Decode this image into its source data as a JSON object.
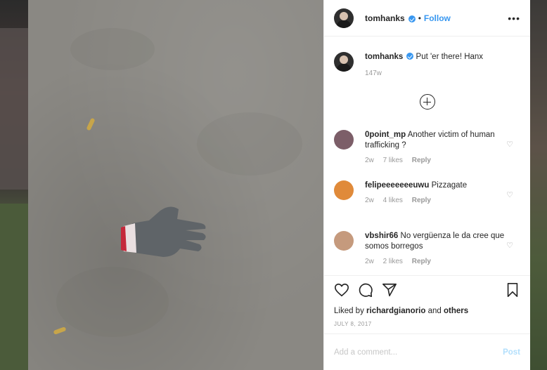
{
  "post": {
    "username": "tomhanks",
    "separator": "•",
    "follow_label": "Follow",
    "more_label": "•••",
    "caption_text": "Put 'er there! Hanx",
    "caption_time": "147w"
  },
  "comments": [
    {
      "user": "0point_mp",
      "text": "Another victim of human trafficking ?",
      "time": "2w",
      "likes": "7 likes",
      "reply": "Reply",
      "avatar_color": "#7c5e68"
    },
    {
      "user": "felipeeeeeeeuwu",
      "text": "Pizzagate",
      "time": "2w",
      "likes": "4 likes",
      "reply": "Reply",
      "avatar_color": "#e08a3a"
    },
    {
      "user": "vbshir66",
      "text": "No vergüenza le da cree que somos borregos",
      "time": "2w",
      "likes": "2 likes",
      "reply": "Reply",
      "avatar_color": "#c59a7d"
    }
  ],
  "likes": {
    "prefix": "Liked by",
    "user": "richardgianorio",
    "conj": "and",
    "others": "others"
  },
  "date": "JULY 8, 2017",
  "add_comment": {
    "placeholder": "Add a comment...",
    "post_label": "Post"
  },
  "icons": [
    "heart-icon",
    "comment-icon",
    "share-icon",
    "bookmark-icon",
    "add-circle-icon",
    "verified-icon",
    "more-icon"
  ]
}
